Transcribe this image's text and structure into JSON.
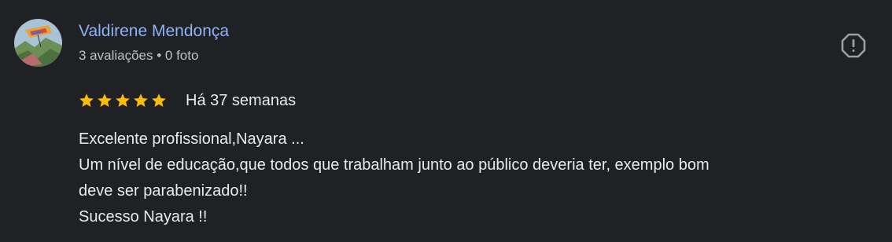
{
  "author": {
    "name": "Valdirene Mendonça",
    "meta": "3 avaliações • 0 foto",
    "avatar_icon": "kite-landscape-avatar"
  },
  "review": {
    "rating": 5,
    "rating_max": 5,
    "date": "Há 37 semanas",
    "lines": [
      "Excelente profissional,Nayara ...",
      "Um nível de educação,que todos que trabalham junto ao público deveria ter, exemplo bom",
      "deve ser parabenizado!!",
      "Sucesso Nayara !!"
    ]
  },
  "icons": {
    "report": "report-icon",
    "star": "star-icon"
  },
  "colors": {
    "background": "#202124",
    "name_link": "#8ab4f8",
    "star": "#fbbc04",
    "text": "#e8eaed",
    "meta_text": "#bdc1c6",
    "icon": "#9aa0a6"
  }
}
